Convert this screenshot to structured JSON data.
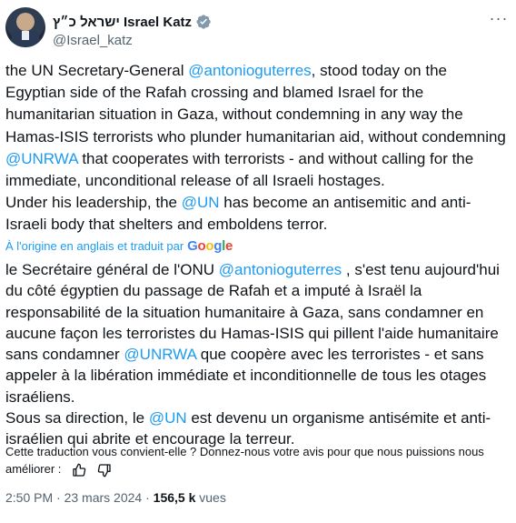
{
  "author": {
    "display_name": "ישראל כ״ץ Israel Katz",
    "handle": "@Israel_katz",
    "verified": true
  },
  "tweet": {
    "segments": [
      {
        "text": "the UN Secretary-General ",
        "type": "text"
      },
      {
        "text": "@antonioguterres",
        "type": "mention"
      },
      {
        "text": ", stood today on the Egyptian side of the Rafah crossing and blamed Israel for the humanitarian situation in Gaza, without condemning in any way the Hamas-ISIS terrorists who plunder humanitarian aid, without condemning ",
        "type": "text"
      },
      {
        "text": "@UNRWA",
        "type": "mention"
      },
      {
        "text": " that cooperates with terrorists - and without calling for the immediate, unconditional release of all Israeli hostages.\nUnder his leadership, the ",
        "type": "text"
      },
      {
        "text": "@UN",
        "type": "mention"
      },
      {
        "text": " has become an antisemitic and anti-Israeli body that shelters and emboldens terror.",
        "type": "text"
      }
    ]
  },
  "translation_notice": {
    "label": "À l'origine en anglais et traduit par",
    "provider": "Google"
  },
  "translation": {
    "segments": [
      {
        "text": "le Secrétaire général de l'ONU ",
        "type": "text"
      },
      {
        "text": "@antonioguterres",
        "type": "mention"
      },
      {
        "text": " , s'est tenu aujourd'hui du côté égyptien du passage de Rafah et a imputé à Israël la responsabilité de la situation humanitaire à Gaza, sans condamner en aucune façon les terroristes du Hamas-ISIS qui pillent l'aide humanitaire sans condamner ",
        "type": "text"
      },
      {
        "text": "@UNRWA",
        "type": "mention"
      },
      {
        "text": " que coopère avec les terroristes - et sans appeler à la libération immédiate et inconditionnelle de tous les otages israéliens.\nSous sa direction, le ",
        "type": "text"
      },
      {
        "text": "@UN",
        "type": "mention"
      },
      {
        "text": " est devenu un organisme antisémite et anti-israélien qui abrite et encourage la terreur.",
        "type": "text"
      }
    ]
  },
  "feedback": {
    "prompt": "Cette traduction vous convient-elle ? Donnez-nous votre avis pour que nous puissions nous améliorer :"
  },
  "meta": {
    "time": "2:50 PM",
    "separator": " · ",
    "date": "23 mars 2024",
    "views_count": "156,5 k",
    "views_label": " vues"
  },
  "colors": {
    "link": "#1d9bf0",
    "secondary_text": "#536471",
    "primary_text": "#0f1419",
    "verified_badge": "#829aab"
  },
  "icons": {
    "verified": "verified-badge-icon",
    "more": "more-options-icon",
    "thumbs_up": "thumbs-up-icon",
    "thumbs_down": "thumbs-down-icon"
  }
}
